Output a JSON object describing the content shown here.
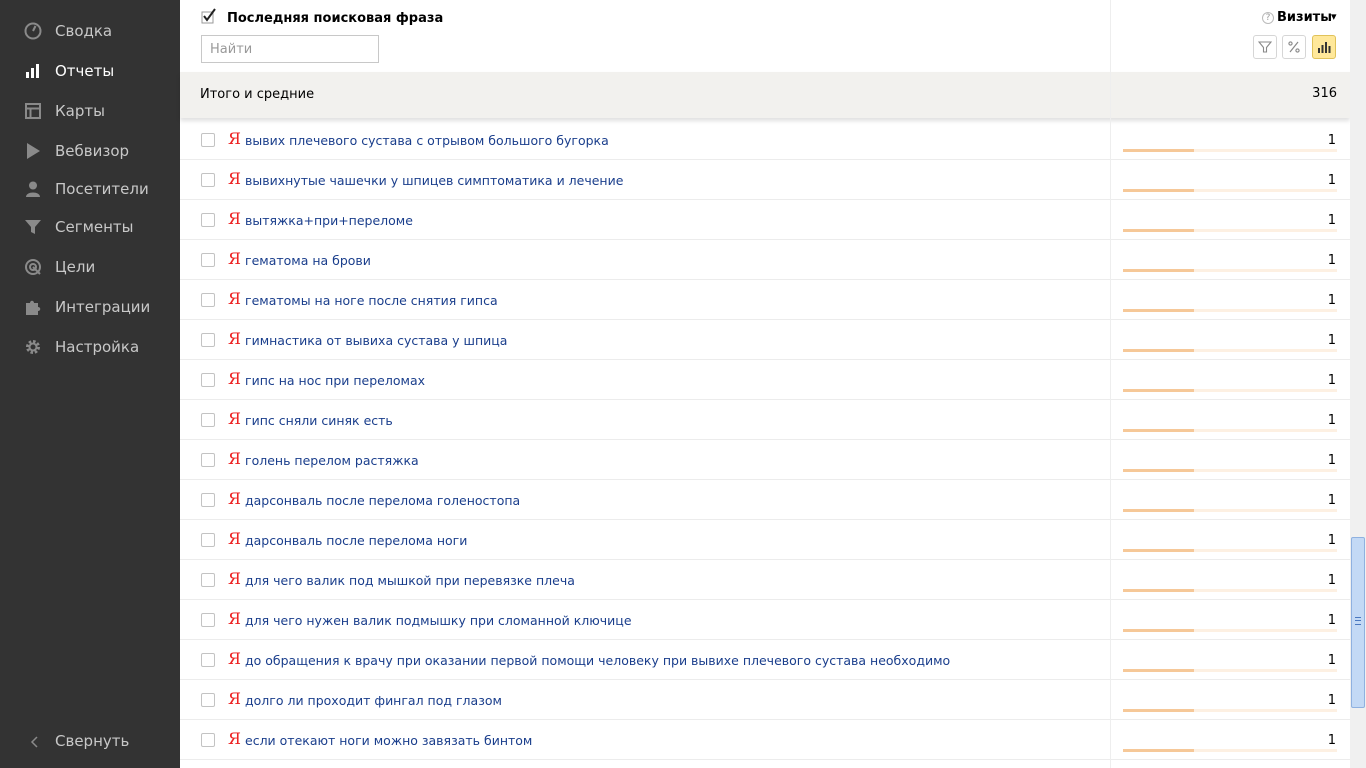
{
  "sidebar": {
    "items": [
      {
        "label": "Сводка",
        "icon": "gauge-icon",
        "active": false
      },
      {
        "label": "Отчеты",
        "icon": "bar-chart-icon",
        "active": true
      },
      {
        "label": "Карты",
        "icon": "map-layout-icon",
        "active": false
      },
      {
        "label": "Вебвизор",
        "icon": "play-icon",
        "active": false
      },
      {
        "label": "Посетители",
        "icon": "user-icon",
        "active": false
      },
      {
        "label": "Сегменты",
        "icon": "funnel-icon",
        "active": false
      },
      {
        "label": "Цели",
        "icon": "target-icon",
        "active": false
      },
      {
        "label": "Интеграции",
        "icon": "puzzle-icon",
        "active": false
      },
      {
        "label": "Настройка",
        "icon": "gear-icon",
        "active": false
      }
    ],
    "collapse_label": "Свернуть"
  },
  "header": {
    "dimension_title": "Последняя поисковая фраза",
    "search_placeholder": "Найти",
    "metric_title": "Визиты",
    "help_glyph": "?",
    "metric_arrow": "▾"
  },
  "totals": {
    "label": "Итого и средние",
    "value": "316"
  },
  "rows": [
    {
      "phrase": "вывих плечевого сустава с отрывом большого бугорка",
      "visits": "1",
      "share": 0.33
    },
    {
      "phrase": "вывихнутые чашечки у шпицев симптоматика и лечение",
      "visits": "1",
      "share": 0.33
    },
    {
      "phrase": "вытяжка+при+переломе",
      "visits": "1",
      "share": 0.33
    },
    {
      "phrase": "гематома на брови",
      "visits": "1",
      "share": 0.33
    },
    {
      "phrase": "гематомы на ноге после снятия гипса",
      "visits": "1",
      "share": 0.33
    },
    {
      "phrase": "гимнастика от вывиха сустава у шпица",
      "visits": "1",
      "share": 0.33
    },
    {
      "phrase": "гипс на нос при переломах",
      "visits": "1",
      "share": 0.33
    },
    {
      "phrase": "гипс сняли синяк есть",
      "visits": "1",
      "share": 0.33
    },
    {
      "phrase": "голень перелом растяжка",
      "visits": "1",
      "share": 0.33
    },
    {
      "phrase": "дарсонваль после перелома голеностопа",
      "visits": "1",
      "share": 0.33
    },
    {
      "phrase": "дарсонваль после перелома ноги",
      "visits": "1",
      "share": 0.33
    },
    {
      "phrase": "для чего валик под мышкой при перевязке плеча",
      "visits": "1",
      "share": 0.33
    },
    {
      "phrase": "для чего нужен валик подмышку при сломанной ключице",
      "visits": "1",
      "share": 0.33
    },
    {
      "phrase": "до обращения к врачу при оказании первой помощи человеку при вывихе плечевого сустава необходимо",
      "visits": "1",
      "share": 0.33
    },
    {
      "phrase": "долго ли проходит фингал под глазом",
      "visits": "1",
      "share": 0.33
    },
    {
      "phrase": "если отекают ноги можно завязать бинтом",
      "visits": "1",
      "share": 0.33
    }
  ],
  "row_icon_glyph": "Я",
  "colors": {
    "sidebar_bg": "#333333",
    "link": "#1a3e8c",
    "yandex_red": "#e22222",
    "bar_fill": "#f6c898",
    "active_tool": "#ffe89a"
  }
}
